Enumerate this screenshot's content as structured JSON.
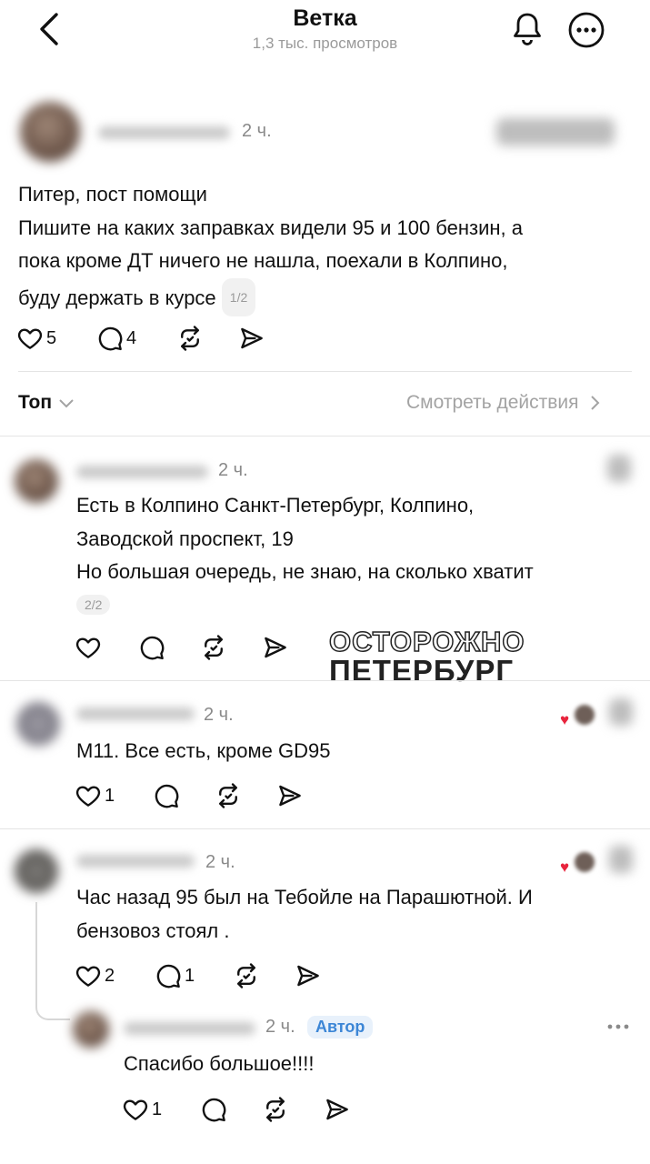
{
  "header": {
    "title": "Ветка",
    "subtitle": "1,3 тыс. просмотров",
    "icons": [
      "chevron-left-icon",
      "bell-icon",
      "more-icon"
    ]
  },
  "post": {
    "time": "2 ч.",
    "text_lines": [
      "Питер, пост помощи",
      "Пишите на каких заправках видели 95 и 100 бензин, а",
      "пока кроме ДТ ничего не нашла, поехали в Колпино,",
      "буду держать в курсе"
    ],
    "page_pill": "1/2",
    "likes": "5",
    "replies": "4"
  },
  "sort_bar": {
    "label": "Топ",
    "see_actions": "Смотреть действия"
  },
  "replies": [
    {
      "time": "2 ч.",
      "text_lines": [
        "Есть в Колпино Санкт-Петербург, Колпино,",
        "Заводской проспект, 19",
        "Но большая очередь, не знаю, на сколько хватит"
      ],
      "page_pill": "2/2"
    },
    {
      "time": "2 ч.",
      "text_lines": [
        "M11. Все есть, кроме GD95"
      ],
      "likes": "1"
    },
    {
      "time": "2 ч.",
      "text_lines": [
        "Час назад 95 был на Тебойле на Парашютной. И",
        "бензовоз стоял ."
      ],
      "likes": "2",
      "replies": "1"
    },
    {
      "time": "2 ч.",
      "author_badge": "Автор",
      "text_lines": [
        "Спасибо большое!!!!"
      ],
      "likes": "1"
    }
  ],
  "watermark": {
    "line1": "ОСТОРОЖНО",
    "line2": "ПЕТЕРБУРГ"
  },
  "colors": {
    "text": "#111111",
    "muted": "#9a9a9a",
    "divider": "#e4e4e4",
    "author_badge": "#3c86d6",
    "like_heart": "#e8243d"
  }
}
